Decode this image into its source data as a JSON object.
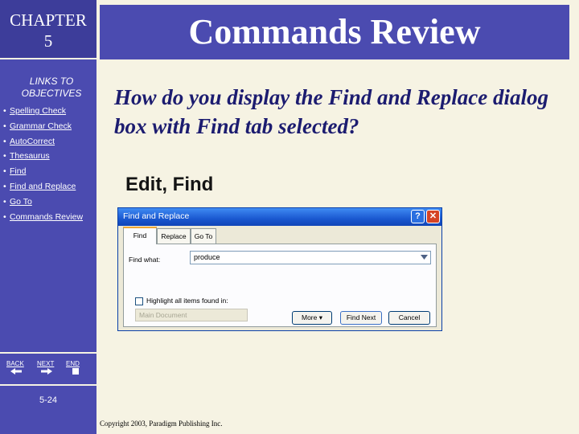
{
  "sidebar": {
    "chapter_line1": "CHAPTER",
    "chapter_line2": "5",
    "links_line1": "LINKS TO",
    "links_line2": "OBJECTIVES",
    "bullet": "•",
    "items": [
      {
        "label": "Spelling Check"
      },
      {
        "label": "Grammar Check"
      },
      {
        "label": "AutoCorrect"
      },
      {
        "label": "Thesaurus"
      },
      {
        "label": "Find"
      },
      {
        "label": "Find and Replace"
      },
      {
        "label": "Go To"
      },
      {
        "label": "Commands Review"
      }
    ],
    "nav_buttons": {
      "back": "BACK",
      "next": "NEXT",
      "end": "END"
    },
    "page_number": "5-24"
  },
  "title": "Commands Review",
  "question": "How do you display the Find and Replace dialog box with Find tab selected?",
  "answer": "Edit, Find",
  "dialog": {
    "title": "Find and Replace",
    "help_label": "?",
    "close_label": "✕",
    "tabs": [
      {
        "label": "Find"
      },
      {
        "label": "Replace"
      },
      {
        "label": "Go To"
      }
    ],
    "find_what_label": "Find what:",
    "find_what_value": "produce",
    "highlight_label": "Highlight all items found in:",
    "highlight_checked": false,
    "scope_value": "Main Document",
    "buttons": {
      "more": "More ▾",
      "find_next": "Find Next",
      "cancel": "Cancel"
    },
    "icons": {
      "dropdown": "chevron-down-icon",
      "help": "help-icon",
      "close": "close-icon"
    }
  },
  "copyright": "Copyright 2003, Paradigm Publishing Inc.",
  "colors": {
    "sidebar_blue": "#4b4bb0",
    "background": "#f6f3e3",
    "question_text": "#1c1c70",
    "xp_title_blue": "#1a58d0"
  }
}
